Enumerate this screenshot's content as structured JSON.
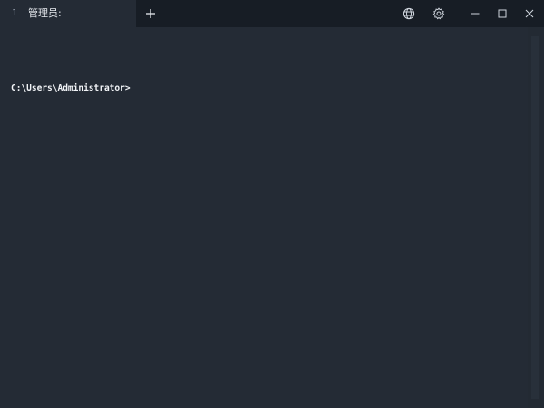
{
  "tab": {
    "index": "1",
    "title": "管理员:"
  },
  "terminal": {
    "prompt": "C:\\Users\\Administrator>"
  },
  "icons": {
    "new_tab": "plus-icon",
    "web": "globe-icon",
    "settings": "gear-icon",
    "minimize": "minimize-icon",
    "maximize": "maximize-icon",
    "close": "close-icon"
  },
  "colors": {
    "titlebar": "#171d25",
    "terminal_bg": "#242b35",
    "text": "#f2f4f7",
    "icon": "#cfd5dd"
  }
}
